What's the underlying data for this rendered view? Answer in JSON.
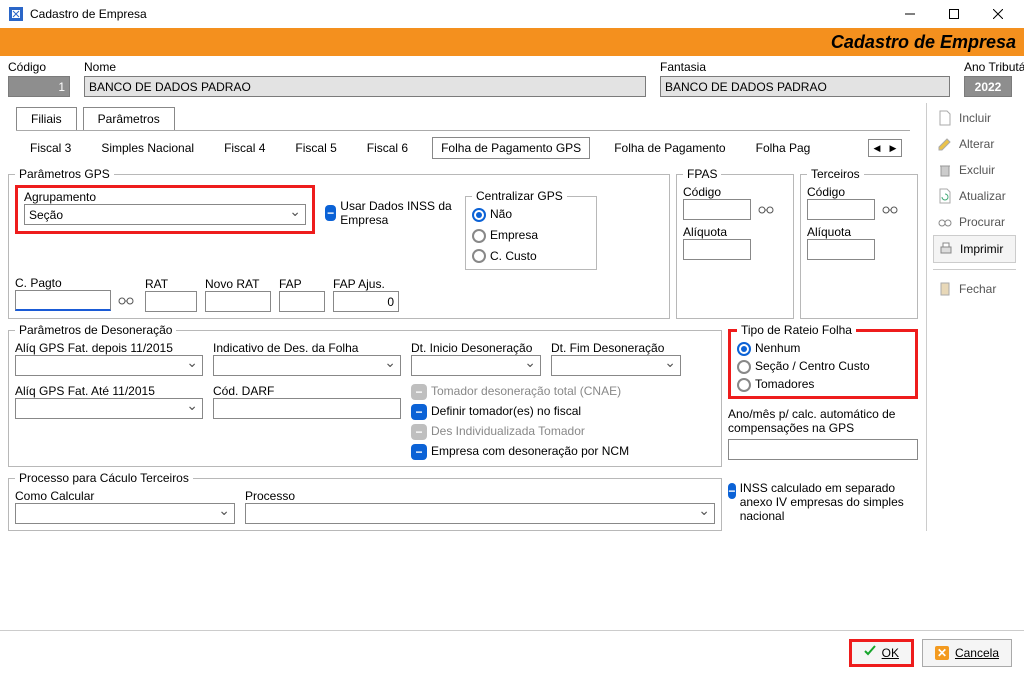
{
  "title": "Cadastro de Empresa",
  "headerbar": "Cadastro de Empresa",
  "labels": {
    "codigo": "Código",
    "nome": "Nome",
    "fantasia": "Fantasia",
    "ano": "Ano Tributário"
  },
  "codigo": "1",
  "nome": "BANCO DE DADOS PADRAO",
  "fantasia": "BANCO DE DADOS PADRAO",
  "ano": "2022",
  "tabs1": {
    "filiais": "Filiais",
    "parametros": "Parâmetros"
  },
  "tabs2": {
    "f3": "Fiscal 3",
    "sn": "Simples Nacional",
    "f4": "Fiscal 4",
    "f5": "Fiscal 5",
    "f6": "Fiscal 6",
    "fgps": "Folha de Pagamento GPS",
    "fp": "Folha de Pagamento",
    "fpag": "Folha Pag"
  },
  "gps": {
    "legend": "Parâmetros GPS",
    "agrup_label": "Agrupamento",
    "agrup_value": "Seção",
    "usar_dados": "Usar Dados INSS da Empresa",
    "central_legend": "Centralizar GPS",
    "central": {
      "nao": "Não",
      "empresa": "Empresa",
      "ccusto": "C. Custo"
    },
    "cpagto": "C. Pagto",
    "rat": "RAT",
    "novorat": "Novo RAT",
    "fap": "FAP",
    "fapajus": "FAP Ajus.",
    "fapajus_value": "0"
  },
  "fpas": {
    "legend": "FPAS",
    "codigo": "Código",
    "aliquota": "Alíquota"
  },
  "terc": {
    "legend": "Terceiros",
    "codigo": "Código",
    "aliquota": "Alíquota"
  },
  "deson": {
    "legend": "Parâmetros de Desoneração",
    "aliq_depois": "Alíq GPS Fat. depois 11/2015",
    "indic": "Indicativo de Des. da Folha",
    "dt_ini": "Dt. Inicio Desoneração",
    "dt_fim": "Dt. Fim Desoneração",
    "aliq_ate": "Alíq GPS Fat. Até 11/2015",
    "darf": "Cód. DARF",
    "chk1": "Tomador desoneração total (CNAE)",
    "chk2": "Definir tomador(es) no fiscal",
    "chk3": "Des Individualizada Tomador",
    "chk4": "Empresa com desoneração por NCM"
  },
  "rateio": {
    "legend": "Tipo de Rateio Folha",
    "nenhum": "Nenhum",
    "secao": "Seção / Centro Custo",
    "tomadores": "Tomadores"
  },
  "anomes": "Ano/mês p/ calc. automático de compensações na GPS",
  "proc": {
    "legend": "Processo para Cáculo Terceiros",
    "como": "Como Calcular",
    "processo": "Processo"
  },
  "inss_sep": "INSS calculado em separado anexo IV empresas do simples nacional",
  "side": {
    "incluir": "Incluir",
    "alterar": "Alterar",
    "excluir": "Excluir",
    "atualizar": "Atualizar",
    "procurar": "Procurar",
    "imprimir": "Imprimir",
    "fechar": "Fechar"
  },
  "footer": {
    "ok": "OK",
    "cancela": "Cancela"
  }
}
